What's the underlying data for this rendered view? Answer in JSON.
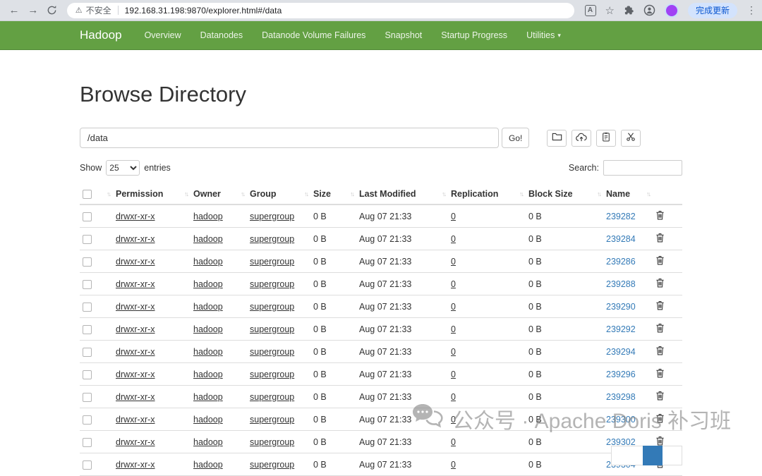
{
  "browser": {
    "security_label": "不安全",
    "url": "192.168.31.198:9870/explorer.html#/data",
    "update_button_label": "完成更新"
  },
  "icons": {
    "back": "←",
    "forward": "→",
    "warning": "⚠",
    "star": "☆",
    "menu_dots": "⋮",
    "caret": "▾",
    "sort": "↑↓",
    "translate": "A"
  },
  "navbar": {
    "brand": "Hadoop",
    "items": [
      {
        "label": "Overview"
      },
      {
        "label": "Datanodes"
      },
      {
        "label": "Datanode Volume Failures"
      },
      {
        "label": "Snapshot"
      },
      {
        "label": "Startup Progress"
      },
      {
        "label": "Utilities",
        "caret": true
      }
    ]
  },
  "explorer": {
    "title": "Browse Directory",
    "path_value": "/data",
    "go_button_label": "Go!",
    "show_label": "Show",
    "entries_label": "entries",
    "page_size_selected": "25",
    "search_label": "Search:",
    "search_value": ""
  },
  "table": {
    "columns": [
      "Permission",
      "Owner",
      "Group",
      "Size",
      "Last Modified",
      "Replication",
      "Block Size",
      "Name"
    ],
    "rows": [
      {
        "permission": "drwxr-xr-x",
        "owner": "hadoop",
        "group": "supergroup",
        "size": "0 B",
        "modified": "Aug 07 21:33",
        "replication": "0",
        "block_size": "0 B",
        "name": "239282"
      },
      {
        "permission": "drwxr-xr-x",
        "owner": "hadoop",
        "group": "supergroup",
        "size": "0 B",
        "modified": "Aug 07 21:33",
        "replication": "0",
        "block_size": "0 B",
        "name": "239284"
      },
      {
        "permission": "drwxr-xr-x",
        "owner": "hadoop",
        "group": "supergroup",
        "size": "0 B",
        "modified": "Aug 07 21:33",
        "replication": "0",
        "block_size": "0 B",
        "name": "239286"
      },
      {
        "permission": "drwxr-xr-x",
        "owner": "hadoop",
        "group": "supergroup",
        "size": "0 B",
        "modified": "Aug 07 21:33",
        "replication": "0",
        "block_size": "0 B",
        "name": "239288"
      },
      {
        "permission": "drwxr-xr-x",
        "owner": "hadoop",
        "group": "supergroup",
        "size": "0 B",
        "modified": "Aug 07 21:33",
        "replication": "0",
        "block_size": "0 B",
        "name": "239290"
      },
      {
        "permission": "drwxr-xr-x",
        "owner": "hadoop",
        "group": "supergroup",
        "size": "0 B",
        "modified": "Aug 07 21:33",
        "replication": "0",
        "block_size": "0 B",
        "name": "239292"
      },
      {
        "permission": "drwxr-xr-x",
        "owner": "hadoop",
        "group": "supergroup",
        "size": "0 B",
        "modified": "Aug 07 21:33",
        "replication": "0",
        "block_size": "0 B",
        "name": "239294"
      },
      {
        "permission": "drwxr-xr-x",
        "owner": "hadoop",
        "group": "supergroup",
        "size": "0 B",
        "modified": "Aug 07 21:33",
        "replication": "0",
        "block_size": "0 B",
        "name": "239296"
      },
      {
        "permission": "drwxr-xr-x",
        "owner": "hadoop",
        "group": "supergroup",
        "size": "0 B",
        "modified": "Aug 07 21:33",
        "replication": "0",
        "block_size": "0 B",
        "name": "239298"
      },
      {
        "permission": "drwxr-xr-x",
        "owner": "hadoop",
        "group": "supergroup",
        "size": "0 B",
        "modified": "Aug 07 21:33",
        "replication": "0",
        "block_size": "0 B",
        "name": "239300"
      },
      {
        "permission": "drwxr-xr-x",
        "owner": "hadoop",
        "group": "supergroup",
        "size": "0 B",
        "modified": "Aug 07 21:33",
        "replication": "0",
        "block_size": "0 B",
        "name": "239302"
      },
      {
        "permission": "drwxr-xr-x",
        "owner": "hadoop",
        "group": "supergroup",
        "size": "0 B",
        "modified": "Aug 07 21:33",
        "replication": "0",
        "block_size": "0 B",
        "name": "239304"
      }
    ]
  },
  "watermark": {
    "text": "公众号 · Apache Doris 补习班"
  },
  "colors": {
    "navbar_green": "#63a043",
    "link_blue": "#337ab7",
    "update_button_bg": "#d3e3fd",
    "update_button_text": "#0b57d0",
    "avatar_purple": "#a142f4"
  }
}
